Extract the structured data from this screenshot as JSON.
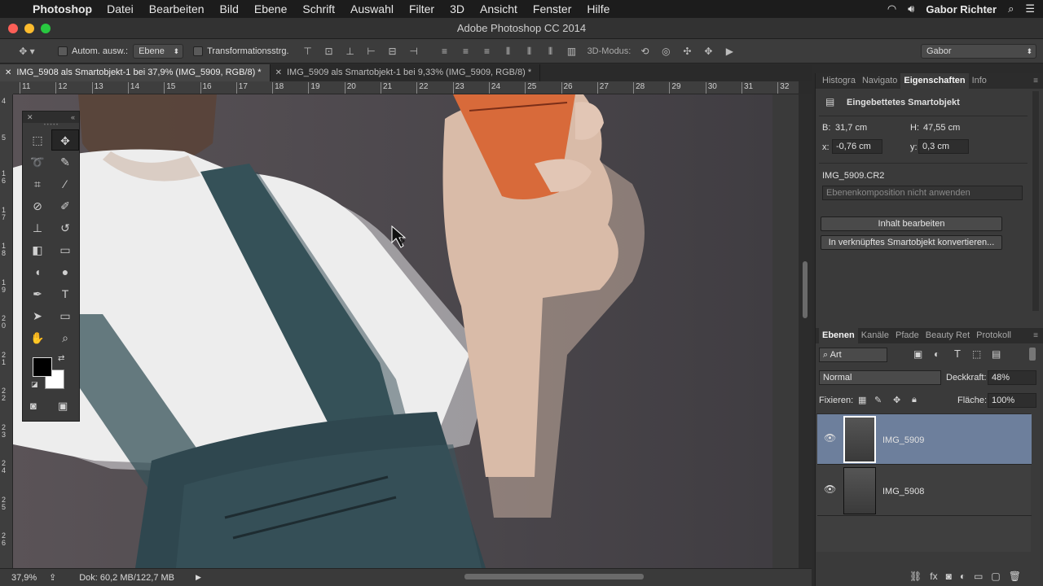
{
  "menubar": {
    "app": "Photoshop",
    "items": [
      "Datei",
      "Bearbeiten",
      "Bild",
      "Ebene",
      "Schrift",
      "Auswahl",
      "Filter",
      "3D",
      "Ansicht",
      "Fenster",
      "Hilfe"
    ],
    "user": "Gabor Richter"
  },
  "window": {
    "title": "Adobe Photoshop CC 2014"
  },
  "options": {
    "auto_select_label": "Autom. ausw.:",
    "auto_select_value": "Ebene",
    "transform_label": "Transformationsstrg.",
    "mode3d_label": "3D-Modus:",
    "workspace": "Gabor"
  },
  "tabs": [
    {
      "label": "IMG_5908 als Smartobjekt-1 bei 37,9% (IMG_5909, RGB/8) *"
    },
    {
      "label": "IMG_5909 als Smartobjekt-1 bei 9,33% (IMG_5909, RGB/8) *"
    }
  ],
  "ruler": {
    "h": [
      "11",
      "12",
      "13",
      "14",
      "15",
      "16",
      "17",
      "18",
      "19",
      "20",
      "21",
      "22",
      "23",
      "24",
      "25",
      "26",
      "27",
      "28",
      "29",
      "30",
      "31",
      "32"
    ],
    "v": [
      "4",
      "5",
      "1 6",
      "1 7",
      "1 8",
      "1 9",
      "2 0",
      "2 1",
      "2 2",
      "2 3",
      "2 4",
      "2 5",
      "2 6"
    ]
  },
  "status": {
    "zoom": "37,9%",
    "doc": "Dok: 60,2 MB/122,7 MB"
  },
  "properties_panel": {
    "tabs": [
      "Histogra",
      "Navigato",
      "Eigenschaften",
      "Info"
    ],
    "type_label": "Eingebettetes Smartobjekt",
    "b_label": "B:",
    "b_value": "31,7 cm",
    "h_label": "H:",
    "h_value": "47,55 cm",
    "x_label": "x:",
    "x_value": "-0,76 cm",
    "y_label": "y:",
    "y_value": "0,3 cm",
    "filename": "IMG_5909.CR2",
    "comp_select": "Ebenenkomposition nicht anwenden",
    "edit_button": "Inhalt bearbeiten",
    "convert_button": "In verknüpftes Smartobjekt konvertieren..."
  },
  "layers_panel": {
    "tabs": [
      "Ebenen",
      "Kanäle",
      "Pfade",
      "Beauty Ret",
      "Protokoll"
    ],
    "filter": "Art",
    "blend_mode": "Normal",
    "opacity_label": "Deckkraft:",
    "opacity_value": "48%",
    "lock_label": "Fixieren:",
    "fill_label": "Fläche:",
    "fill_value": "100%",
    "layers": [
      {
        "name": "IMG_5909",
        "selected": true
      },
      {
        "name": "IMG_5908",
        "selected": false
      }
    ]
  },
  "colors": {
    "accent_selected": "#6d7f9c",
    "panel": "#3a3a3a"
  }
}
